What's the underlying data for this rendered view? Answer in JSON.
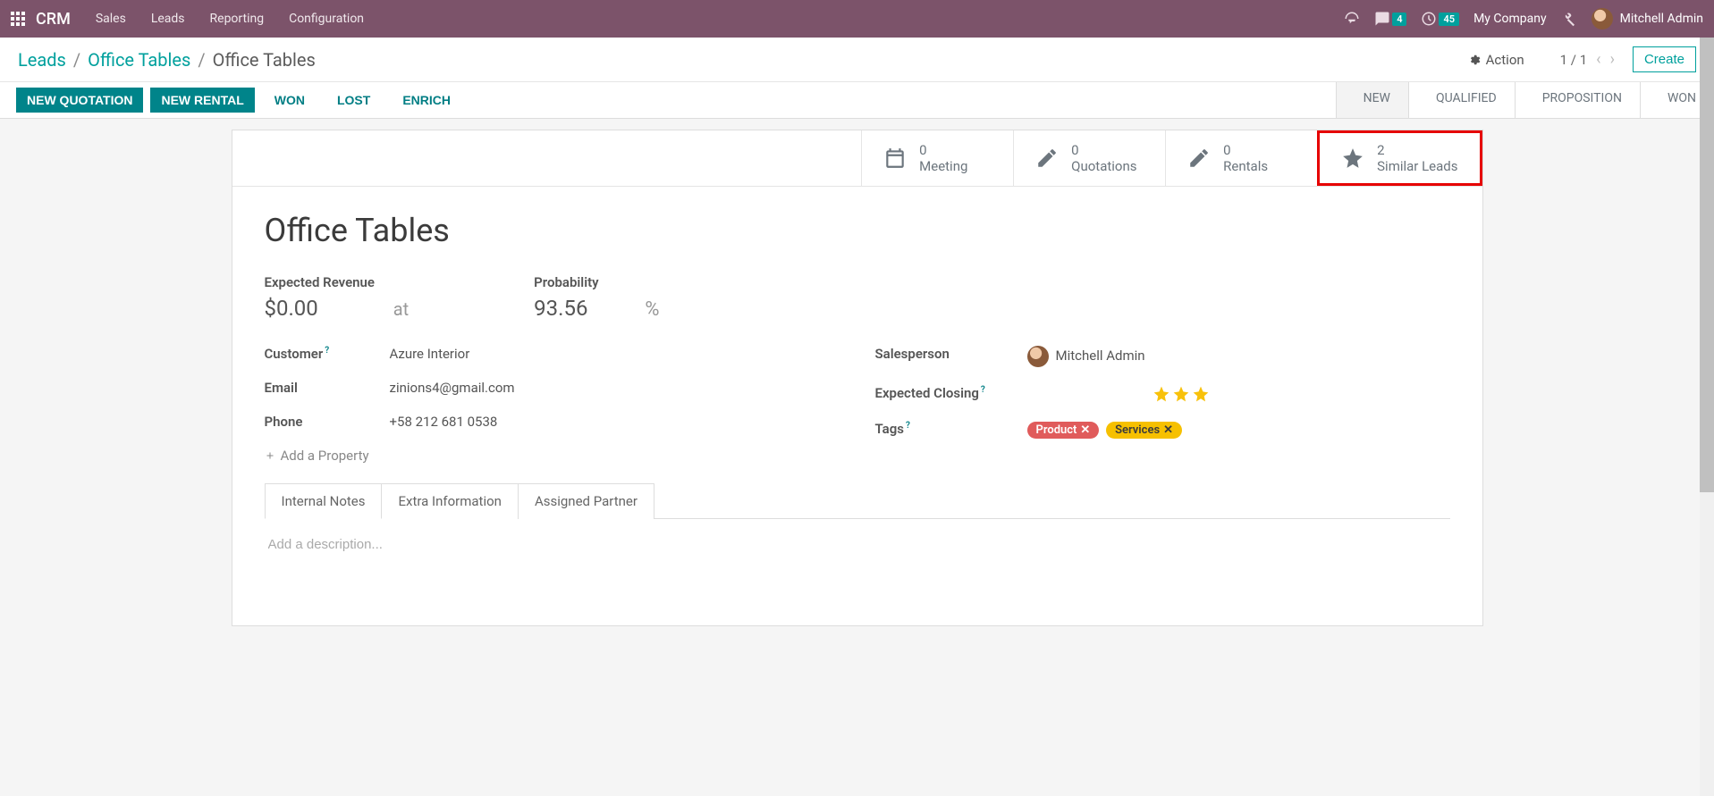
{
  "topnav": {
    "brand": "CRM",
    "links": [
      "Sales",
      "Leads",
      "Reporting",
      "Configuration"
    ],
    "chat_badge": "4",
    "clock_badge": "45",
    "company": "My Company",
    "user": "Mitchell Admin"
  },
  "breadcrumb": {
    "items": [
      "Leads",
      "Office Tables"
    ],
    "current": "Office Tables"
  },
  "controls": {
    "action": "Action",
    "pager": "1 / 1",
    "create": "Create"
  },
  "toolbar": {
    "new_quotation": "NEW QUOTATION",
    "new_rental": "NEW RENTAL",
    "won": "WON",
    "lost": "LOST",
    "enrich": "ENRICH"
  },
  "stages": [
    "NEW",
    "QUALIFIED",
    "PROPOSITION",
    "WON"
  ],
  "stats": {
    "meeting": {
      "n": "0",
      "label": "Meeting"
    },
    "quotations": {
      "n": "0",
      "label": "Quotations"
    },
    "rentals": {
      "n": "0",
      "label": "Rentals"
    },
    "similar": {
      "n": "2",
      "label": "Similar Leads"
    }
  },
  "lead": {
    "title": "Office Tables",
    "expected_revenue_label": "Expected Revenue",
    "expected_revenue": "$0.00",
    "at": "at",
    "probability_label": "Probability",
    "probability": "93.56",
    "pct": "%",
    "customer_label": "Customer",
    "customer": "Azure Interior",
    "email_label": "Email",
    "email": "zinions4@gmail.com",
    "phone_label": "Phone",
    "phone": "+58 212 681 0538",
    "add_property": "Add a Property",
    "salesperson_label": "Salesperson",
    "salesperson": "Mitchell Admin",
    "closing_label": "Expected Closing",
    "tags_label": "Tags",
    "tags": [
      {
        "name": "Product",
        "color": "red"
      },
      {
        "name": "Services",
        "color": "yellow"
      }
    ]
  },
  "tabs": {
    "items": [
      "Internal Notes",
      "Extra Information",
      "Assigned Partner"
    ],
    "active": 0
  },
  "desc_placeholder": "Add a description..."
}
